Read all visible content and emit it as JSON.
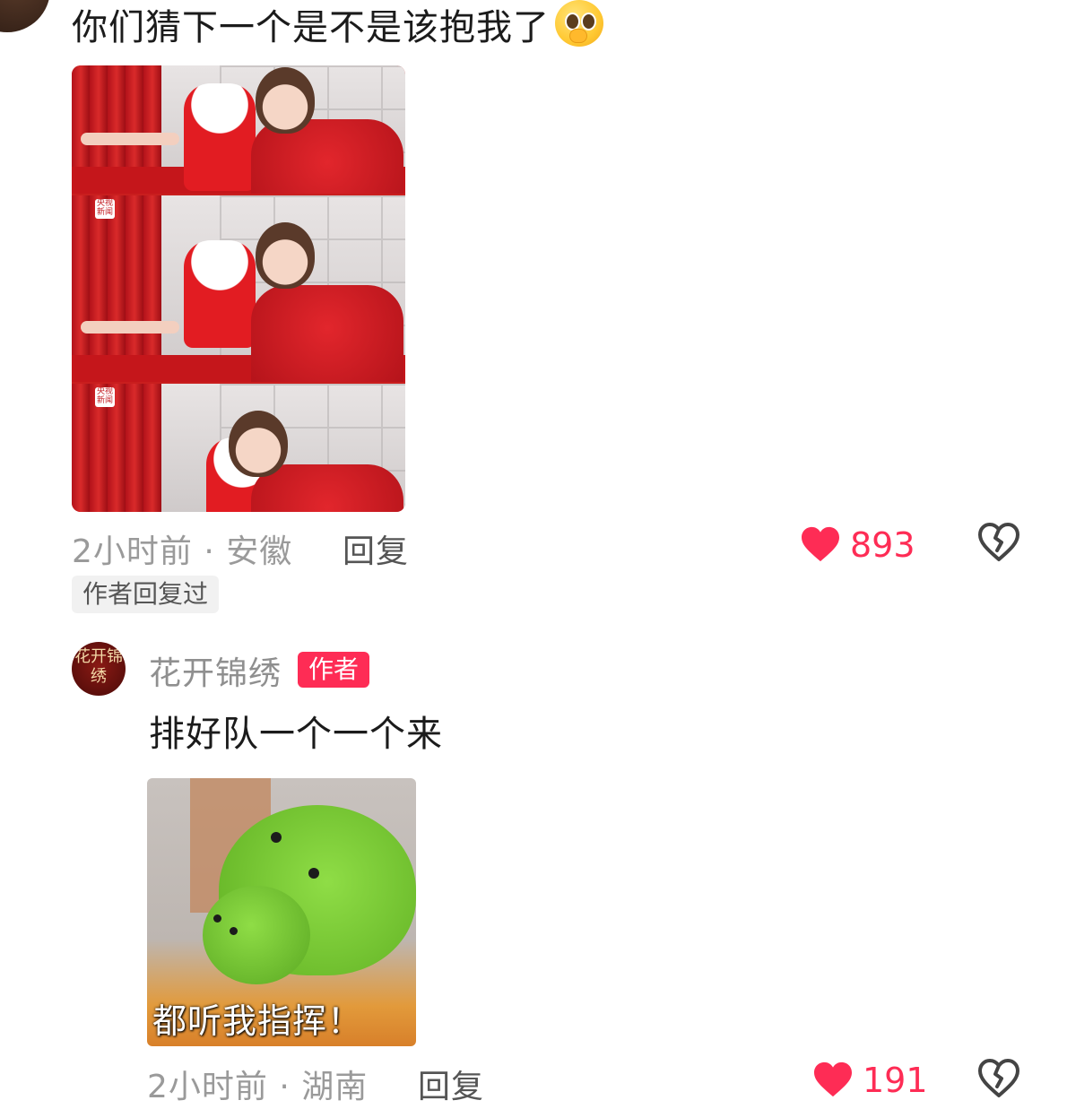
{
  "comment": {
    "text": "你们猜下一个是不是该抱我了",
    "emoji": "pleading-face-emoji",
    "image_watermark": "央视新闻",
    "time_location": "2小时前 · 安徽",
    "reply_label": "回复",
    "like_count": "893",
    "author_replied_badge": "作者回复过"
  },
  "reply": {
    "author_name": "花开锦绣",
    "author_tag": "作者",
    "avatar_text": "花开锦绣",
    "text": "排好队一个一个来",
    "sticker_caption": "都听我指挥！",
    "time_location": "2小时前 · 湖南",
    "reply_label": "回复",
    "like_count": "191"
  },
  "colors": {
    "accent": "#fe2c55",
    "meta_text": "#9a9a9a"
  },
  "icons": {
    "like": "heart-icon",
    "dislike": "broken-heart-icon"
  }
}
